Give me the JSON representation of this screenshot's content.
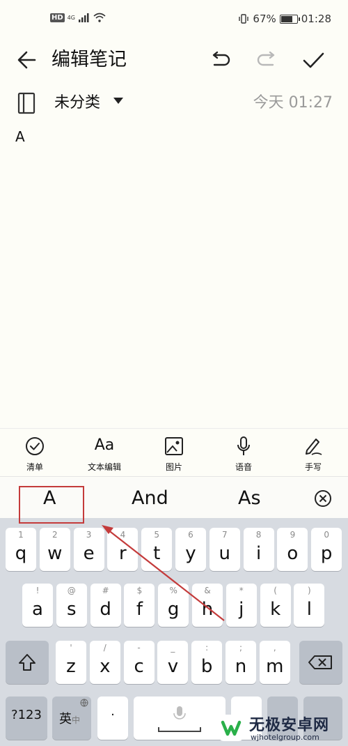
{
  "status_bar": {
    "hd": "HD",
    "network": "4G",
    "battery_percent": "67%",
    "battery_level": 0.67,
    "time": "01:28"
  },
  "header": {
    "title": "编辑笔记",
    "icons": {
      "back": "arrow-left-icon",
      "undo": "undo-icon",
      "redo": "redo-icon",
      "done": "check-icon"
    }
  },
  "note": {
    "category": "未分类",
    "timestamp": "今天 01:27",
    "content": "A"
  },
  "toolbar": {
    "items": [
      {
        "label": "清单",
        "icon": "checklist-icon"
      },
      {
        "label": "文本编辑",
        "icon": "Aa"
      },
      {
        "label": "图片",
        "icon": "image-icon"
      },
      {
        "label": "语音",
        "icon": "microphone-icon"
      },
      {
        "label": "手写",
        "icon": "handwriting-icon"
      }
    ]
  },
  "candidates": {
    "items": [
      "A",
      "And",
      "As"
    ],
    "icon": "close-circle-icon"
  },
  "keyboard": {
    "row1": [
      {
        "hint": "1",
        "key": "q"
      },
      {
        "hint": "2",
        "key": "w"
      },
      {
        "hint": "3",
        "key": "e"
      },
      {
        "hint": "4",
        "key": "r"
      },
      {
        "hint": "5",
        "key": "t"
      },
      {
        "hint": "6",
        "key": "y"
      },
      {
        "hint": "7",
        "key": "u"
      },
      {
        "hint": "8",
        "key": "i"
      },
      {
        "hint": "9",
        "key": "o"
      },
      {
        "hint": "0",
        "key": "p"
      }
    ],
    "row2": [
      {
        "hint": "!",
        "key": "a"
      },
      {
        "hint": "@",
        "key": "s"
      },
      {
        "hint": "#",
        "key": "d"
      },
      {
        "hint": "$",
        "key": "f"
      },
      {
        "hint": "%",
        "key": "g"
      },
      {
        "hint": "&",
        "key": "h"
      },
      {
        "hint": "*",
        "key": "j"
      },
      {
        "hint": "(",
        "key": "k"
      },
      {
        "hint": ")",
        "key": "l"
      }
    ],
    "row3": [
      {
        "hint": "'",
        "key": "z"
      },
      {
        "hint": "/",
        "key": "x"
      },
      {
        "hint": "-",
        "key": "c"
      },
      {
        "hint": "_",
        "key": "v"
      },
      {
        "hint": ":",
        "key": "b"
      },
      {
        "hint": ";",
        "key": "n"
      },
      {
        "hint": ",",
        "key": "m"
      }
    ],
    "symbols_key": "?123",
    "lang_key": "英",
    "lang_key_sub": "中",
    "dot_key": "·"
  },
  "watermark": {
    "title": "无极安卓网",
    "url": "wjhotelgroup.com"
  },
  "colors": {
    "annotation": "#c43b3b",
    "keyboard_bg": "#d7dbe1"
  }
}
